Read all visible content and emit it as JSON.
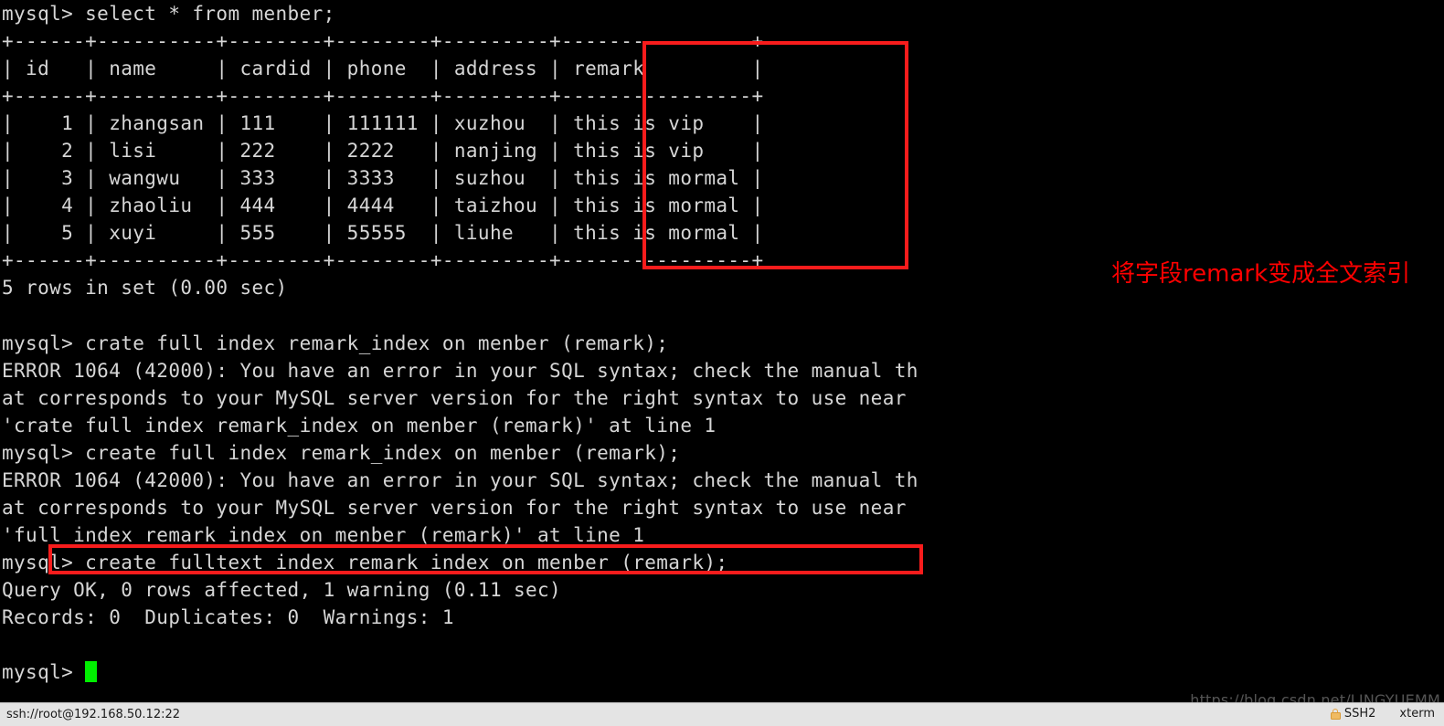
{
  "terminal": {
    "prompt": "mysql>",
    "lines": [
      "mysql> select * from menber;",
      "+------+----------+--------+--------+---------+----------------+",
      "| id   | name     | cardid | phone  | address | remark         |",
      "+------+----------+--------+--------+---------+----------------+",
      "|    1 | zhangsan | 111    | 111111 | xuzhou  | this is vip    |",
      "|    2 | lisi     | 222    | 2222   | nanjing | this is vip    |",
      "|    3 | wangwu   | 333    | 3333   | suzhou  | this is mormal |",
      "|    4 | zhaoliu  | 444    | 4444   | taizhou | this is mormal |",
      "|    5 | xuyi     | 555    | 55555  | liuhe   | this is mormal |",
      "+------+----------+--------+--------+---------+----------------+",
      "5 rows in set (0.00 sec)",
      "",
      "mysql> crate full index remark_index on menber (remark);",
      "ERROR 1064 (42000): You have an error in your SQL syntax; check the manual th",
      "at corresponds to your MySQL server version for the right syntax to use near",
      "'crate full index remark_index on menber (remark)' at line 1",
      "mysql> create full index remark_index on menber (remark);",
      "ERROR 1064 (42000): You have an error in your SQL syntax; check the manual th",
      "at corresponds to your MySQL server version for the right syntax to use near",
      "'full index remark_index on menber (remark)' at line 1",
      "mysql> create fulltext index remark_index on menber (remark);",
      "Query OK, 0 rows affected, 1 warning (0.11 sec)",
      "Records: 0  Duplicates: 0  Warnings: 1",
      "",
      "mysql> "
    ],
    "table": {
      "name": "menber",
      "query": "select * from menber;",
      "columns": [
        "id",
        "name",
        "cardid",
        "phone",
        "address",
        "remark"
      ],
      "rows": [
        [
          "1",
          "zhangsan",
          "111",
          "111111",
          "xuzhou",
          "this is vip"
        ],
        [
          "2",
          "lisi",
          "222",
          "2222",
          "nanjing",
          "this is vip"
        ],
        [
          "3",
          "wangwu",
          "333",
          "3333",
          "suzhou",
          "this is mormal"
        ],
        [
          "4",
          "zhaoliu",
          "444",
          "4444",
          "taizhou",
          "this is mormal"
        ],
        [
          "5",
          "xuyi",
          "555",
          "55555",
          "liuhe",
          "this is mormal"
        ]
      ],
      "result_summary": "5 rows in set (0.00 sec)"
    },
    "colors": {
      "background": "#000000",
      "text": "#d6d6d6",
      "cursor": "#00ef00",
      "annotation": "#ff0000"
    }
  },
  "annotation": {
    "text": "将字段remark变成全文索引",
    "color": "#ff0000"
  },
  "watermark": {
    "text": "https://blog.csdn.net/LINGYUEMM"
  },
  "statusbar": {
    "connection": "ssh://root@192.168.50.12:22",
    "protocol": "SSH2",
    "terminal_type": "xterm"
  }
}
